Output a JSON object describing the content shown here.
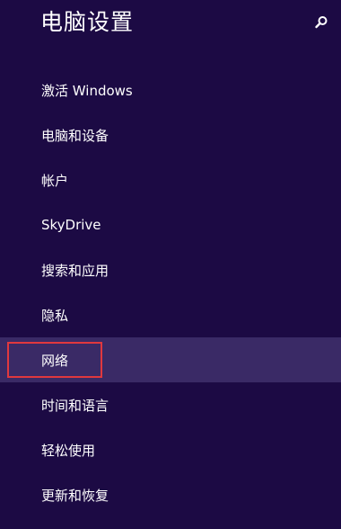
{
  "header": {
    "title": "电脑设置",
    "search_icon": "search-icon"
  },
  "menu": {
    "items": [
      {
        "label": "激活 Windows"
      },
      {
        "label": "电脑和设备"
      },
      {
        "label": "帐户"
      },
      {
        "label": "SkyDrive"
      },
      {
        "label": "搜索和应用"
      },
      {
        "label": "隐私"
      },
      {
        "label": "网络",
        "selected": true
      },
      {
        "label": "时间和语言"
      },
      {
        "label": "轻松使用"
      },
      {
        "label": "更新和恢复"
      }
    ]
  },
  "colors": {
    "background": "#1c0a44",
    "selected_background": "#3a2a66",
    "highlight_border": "#e0383e",
    "text": "#ffffff"
  }
}
